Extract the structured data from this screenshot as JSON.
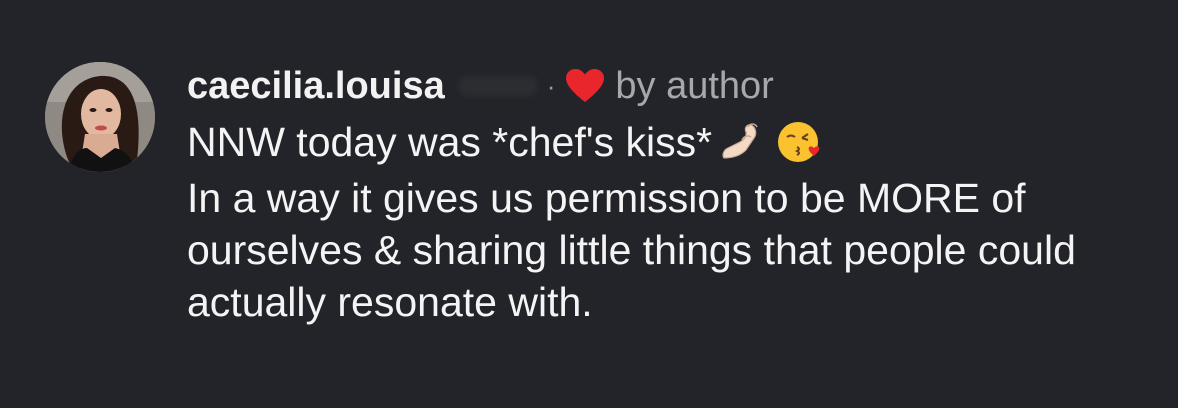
{
  "comment": {
    "username": "caecilia.louisa",
    "separator": "·",
    "liked_label": "by author",
    "line1": "NNW today was *chef's kiss*",
    "emoji_icons": [
      "pinched-fingers-icon",
      "kiss-face-icon"
    ],
    "paragraph2": "In a way it gives us permission to be MORE of ourselves & sharing little things that people could actually resonate with."
  },
  "colors": {
    "background": "#232429",
    "text": "#f4f4f4",
    "secondary_text": "#a7a8ac",
    "heart": "#e8262c"
  }
}
